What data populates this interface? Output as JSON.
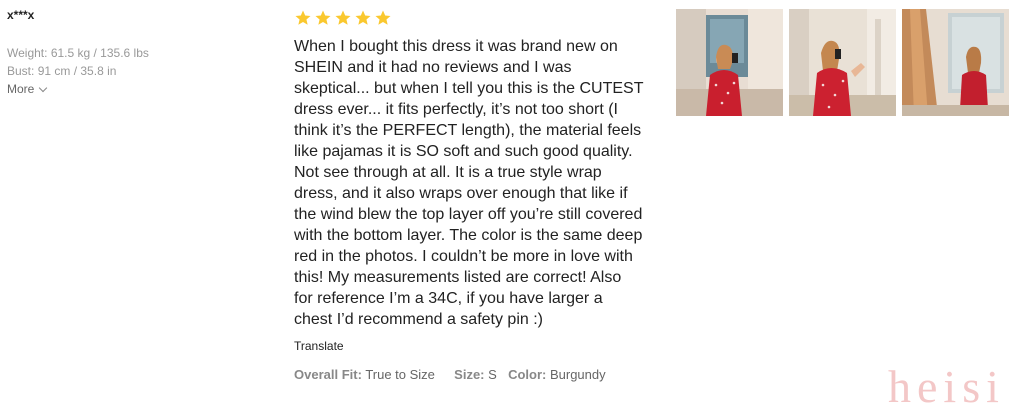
{
  "reviewer": {
    "name": "x***x",
    "weight_label": "Weight:",
    "weight_value": "61.5 kg / 135.6 lbs",
    "bust_label": "Bust:",
    "bust_value": "91 cm / 35.8 in",
    "more_label": "More"
  },
  "review": {
    "rating": 5,
    "star_color": "#fac82f",
    "text": "When I bought this dress it was brand new on SHEIN and it had no reviews and I was skeptical... but when I tell you this is the CUTEST dress ever... it fits perfectly, it’s not too short (I think it’s the PERFECT length), the material feels like pajamas it is SO soft and such good quality. Not see through at all. It is a true style wrap dress, and it also wraps over enough that like if the wind blew the top layer off you’re still covered with the bottom layer. The color is the same deep red in the photos. I couldn’t be more in love with this! My measurements listed are correct! Also for reference I’m a 34C, if you have larger a chest I’d recommend a safety pin :)",
    "translate_label": "Translate",
    "overall_fit_label": "Overall Fit:",
    "overall_fit_value": "True to Size",
    "size_label": "Size:",
    "size_value": "S",
    "color_label": "Color:",
    "color_value": "Burgundy"
  },
  "photos": [
    {
      "icon": "review-photo-mirror-selfie"
    },
    {
      "icon": "review-photo-mirror-selfie"
    },
    {
      "icon": "review-photo-mirror-back"
    }
  ],
  "watermark": "heisi"
}
